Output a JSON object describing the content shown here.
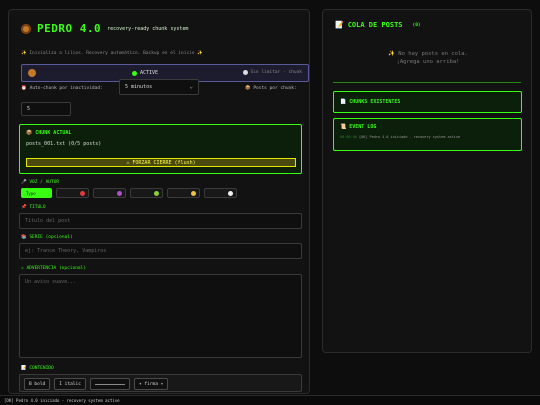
{
  "app": {
    "title": "PEDRO 4.0",
    "subtitle": "recovery-ready chunk system",
    "tagline": "✨ Inicializa a lilios. Recovery automático. Backup en el inicio ✨"
  },
  "status": {
    "active_label": "ACTIVE",
    "idle_label": "Sin limitar · chunk",
    "accent": "#39ff14"
  },
  "controls": {
    "auto_chunk_label": "Auto-chunk por inactividad:",
    "interval_value": "5 minutos",
    "posts_per_chunk_label": "Posts por chunk:",
    "posts_per_chunk_value": "5"
  },
  "current_chunk": {
    "heading": "CHUNK ACTUAL",
    "file": "posts_001.txt (0/5 posts)",
    "force_button": "⚠ FORZAR CIERRE (flush)"
  },
  "voice": {
    "label": "VOZ / AUTOR",
    "options": [
      {
        "name": "Typo",
        "color": "#39ff14",
        "selected": true
      },
      {
        "name": "",
        "color": "#e03a3a",
        "selected": false
      },
      {
        "name": "",
        "color": "#b050c8",
        "selected": false
      },
      {
        "name": "",
        "color": "#8ad03a",
        "selected": false
      },
      {
        "name": "",
        "color": "#f0c040",
        "selected": false
      },
      {
        "name": "",
        "color": "#f0f0f0",
        "selected": false
      }
    ]
  },
  "form": {
    "title_label": "TITULO",
    "title_placeholder": "Título del post",
    "series_label": "SERIE (opcional)",
    "series_placeholder": "ej: Trance Theory, Vampiros",
    "warning_label": "ADVERTENCIA (opcional)",
    "warning_placeholder": "Un aviso suave...",
    "content_label": "CONTENIDO"
  },
  "toolbar": {
    "bold": "B bold",
    "italic": "I italic",
    "signature": "✦ firma ✦"
  },
  "queue": {
    "title": "COLA DE POSTS",
    "count": "(0)",
    "empty_line1": "✨ No hay posts en cola.",
    "empty_line2": "¡Agrega uno arriba!"
  },
  "chunks_existing": {
    "heading": "CHUNKS EXISTENTES"
  },
  "event_log": {
    "heading": "EVENT LOG",
    "entry_time": "00:00:00",
    "entry_text": "[OK] Pedro 4.0 iniciado - recovery system active"
  },
  "footer": {
    "text": "[OK] Pedro 4.0 iniciado - recovery system active"
  }
}
